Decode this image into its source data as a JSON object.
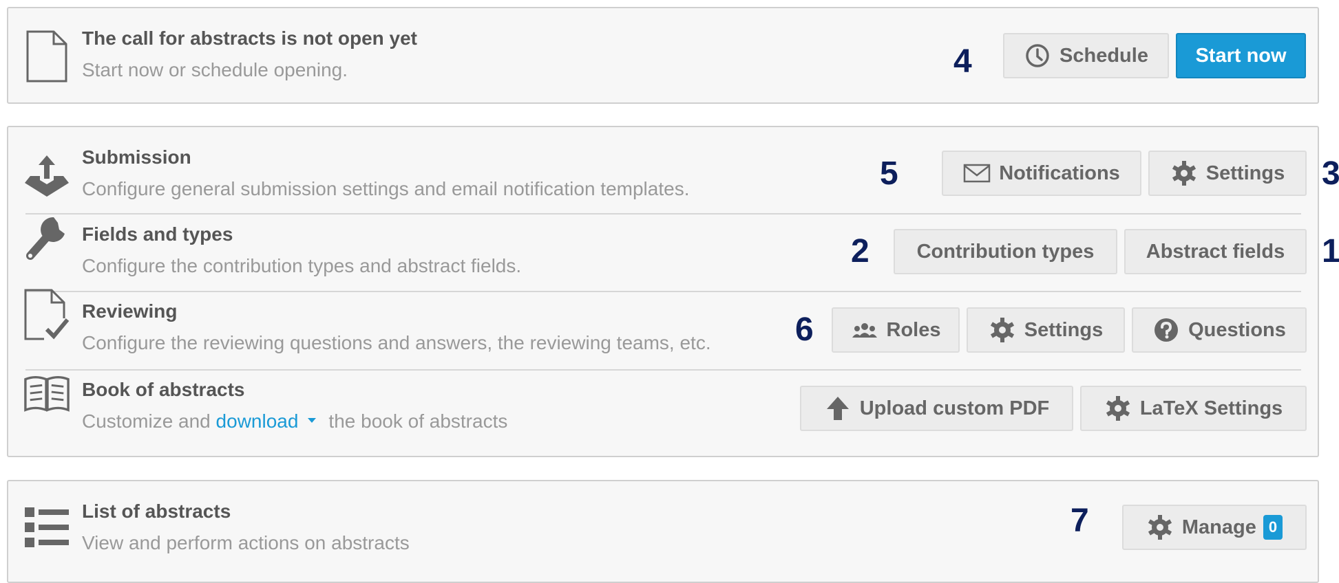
{
  "cfa": {
    "title": "The call for abstracts is not open yet",
    "desc": "Start now or schedule opening.",
    "schedule_label": "Schedule",
    "start_label": "Start now"
  },
  "submission": {
    "title": "Submission",
    "desc": "Configure general submission settings and email notification templates.",
    "notifications_label": "Notifications",
    "settings_label": "Settings"
  },
  "fields": {
    "title": "Fields and types",
    "desc": "Configure the contribution types and abstract fields.",
    "contribution_types_label": "Contribution types",
    "abstract_fields_label": "Abstract fields"
  },
  "reviewing": {
    "title": "Reviewing",
    "desc": "Configure the reviewing questions and answers, the reviewing teams, etc.",
    "roles_label": "Roles",
    "settings_label": "Settings",
    "questions_label": "Questions"
  },
  "book": {
    "title": "Book of abstracts",
    "desc_before": "Customize and",
    "desc_link": "download",
    "desc_after": "the book of abstracts",
    "upload_label": "Upload custom PDF",
    "latex_label": "LaTeX Settings"
  },
  "list": {
    "title": "List of abstracts",
    "desc": "View and perform actions on abstracts",
    "manage_label": "Manage",
    "manage_count": "0"
  },
  "callouts": {
    "n1": "1",
    "n2": "2",
    "n3": "3",
    "n4": "4",
    "n5": "5",
    "n6": "6",
    "n7": "7"
  },
  "colors": {
    "accent": "#1a9ad6",
    "callout": "#0d1f5c"
  },
  "icons": {
    "cfa": "document-icon",
    "submission": "upload-tray-icon",
    "fields": "wrench-icon",
    "reviewing": "document-check-icon",
    "book": "open-book-icon",
    "list": "list-icon"
  }
}
